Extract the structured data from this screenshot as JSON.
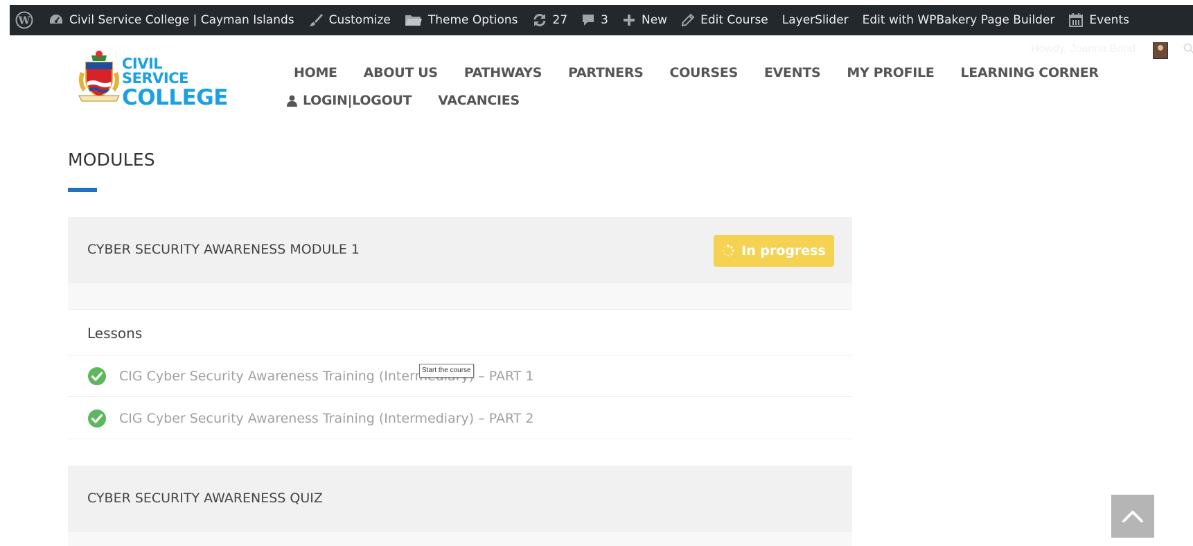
{
  "adminbar": {
    "site_name": "Civil Service College | Cayman Islands",
    "customize": "Customize",
    "theme_options": "Theme Options",
    "updates_count": "27",
    "comments_count": "3",
    "new": "New",
    "edit_course": "Edit Course",
    "layerslider": "LayerSlider",
    "wpbakery": "Edit with WPBakery Page Builder",
    "events": "Events",
    "colors": {
      "bg": "#23282d",
      "text": "#eeeeee",
      "icon": "#a0a5aa"
    }
  },
  "header": {
    "logo_line1": "CIVIL SERVICE",
    "logo_line2": "COLLEGE",
    "howdy": "Howdy, Joanna Bond",
    "nav_row1": [
      "HOME",
      "ABOUT US",
      "PATHWAYS",
      "PARTNERS",
      "COURSES",
      "EVENTS",
      "MY PROFILE",
      "LEARNING CORNER"
    ],
    "nav_login": "LOGIN|LOGOUT",
    "nav_vacancies": "VACANCIES"
  },
  "content": {
    "title": "MODULES",
    "accent": "#1e73be",
    "module1": {
      "title": "CYBER SECURITY AWARENESS MODULE 1",
      "status": "In progress",
      "status_color": "#f6d252",
      "lessons_heading": "Lessons",
      "lessons": [
        "CIG Cyber Security Awareness Training (Intermediary) – PART 1",
        "CIG Cyber Security Awareness Training (Intermediary) – PART 2"
      ],
      "completed_color": "#5cb85c"
    },
    "tooltip": "Start the course",
    "module2": {
      "title": "CYBER SECURITY AWARENESS QUIZ"
    }
  },
  "icons": {
    "admin": [
      "wordpress-icon",
      "dashboard-icon",
      "brush-icon",
      "folder-icon",
      "refresh-icon",
      "comment-icon",
      "plus-icon",
      "pencil-icon",
      "calendar-icon"
    ],
    "header": [
      "user-icon",
      "search-icon"
    ],
    "content": [
      "spinner-icon",
      "check-circle-icon",
      "chevron-up-icon"
    ]
  }
}
